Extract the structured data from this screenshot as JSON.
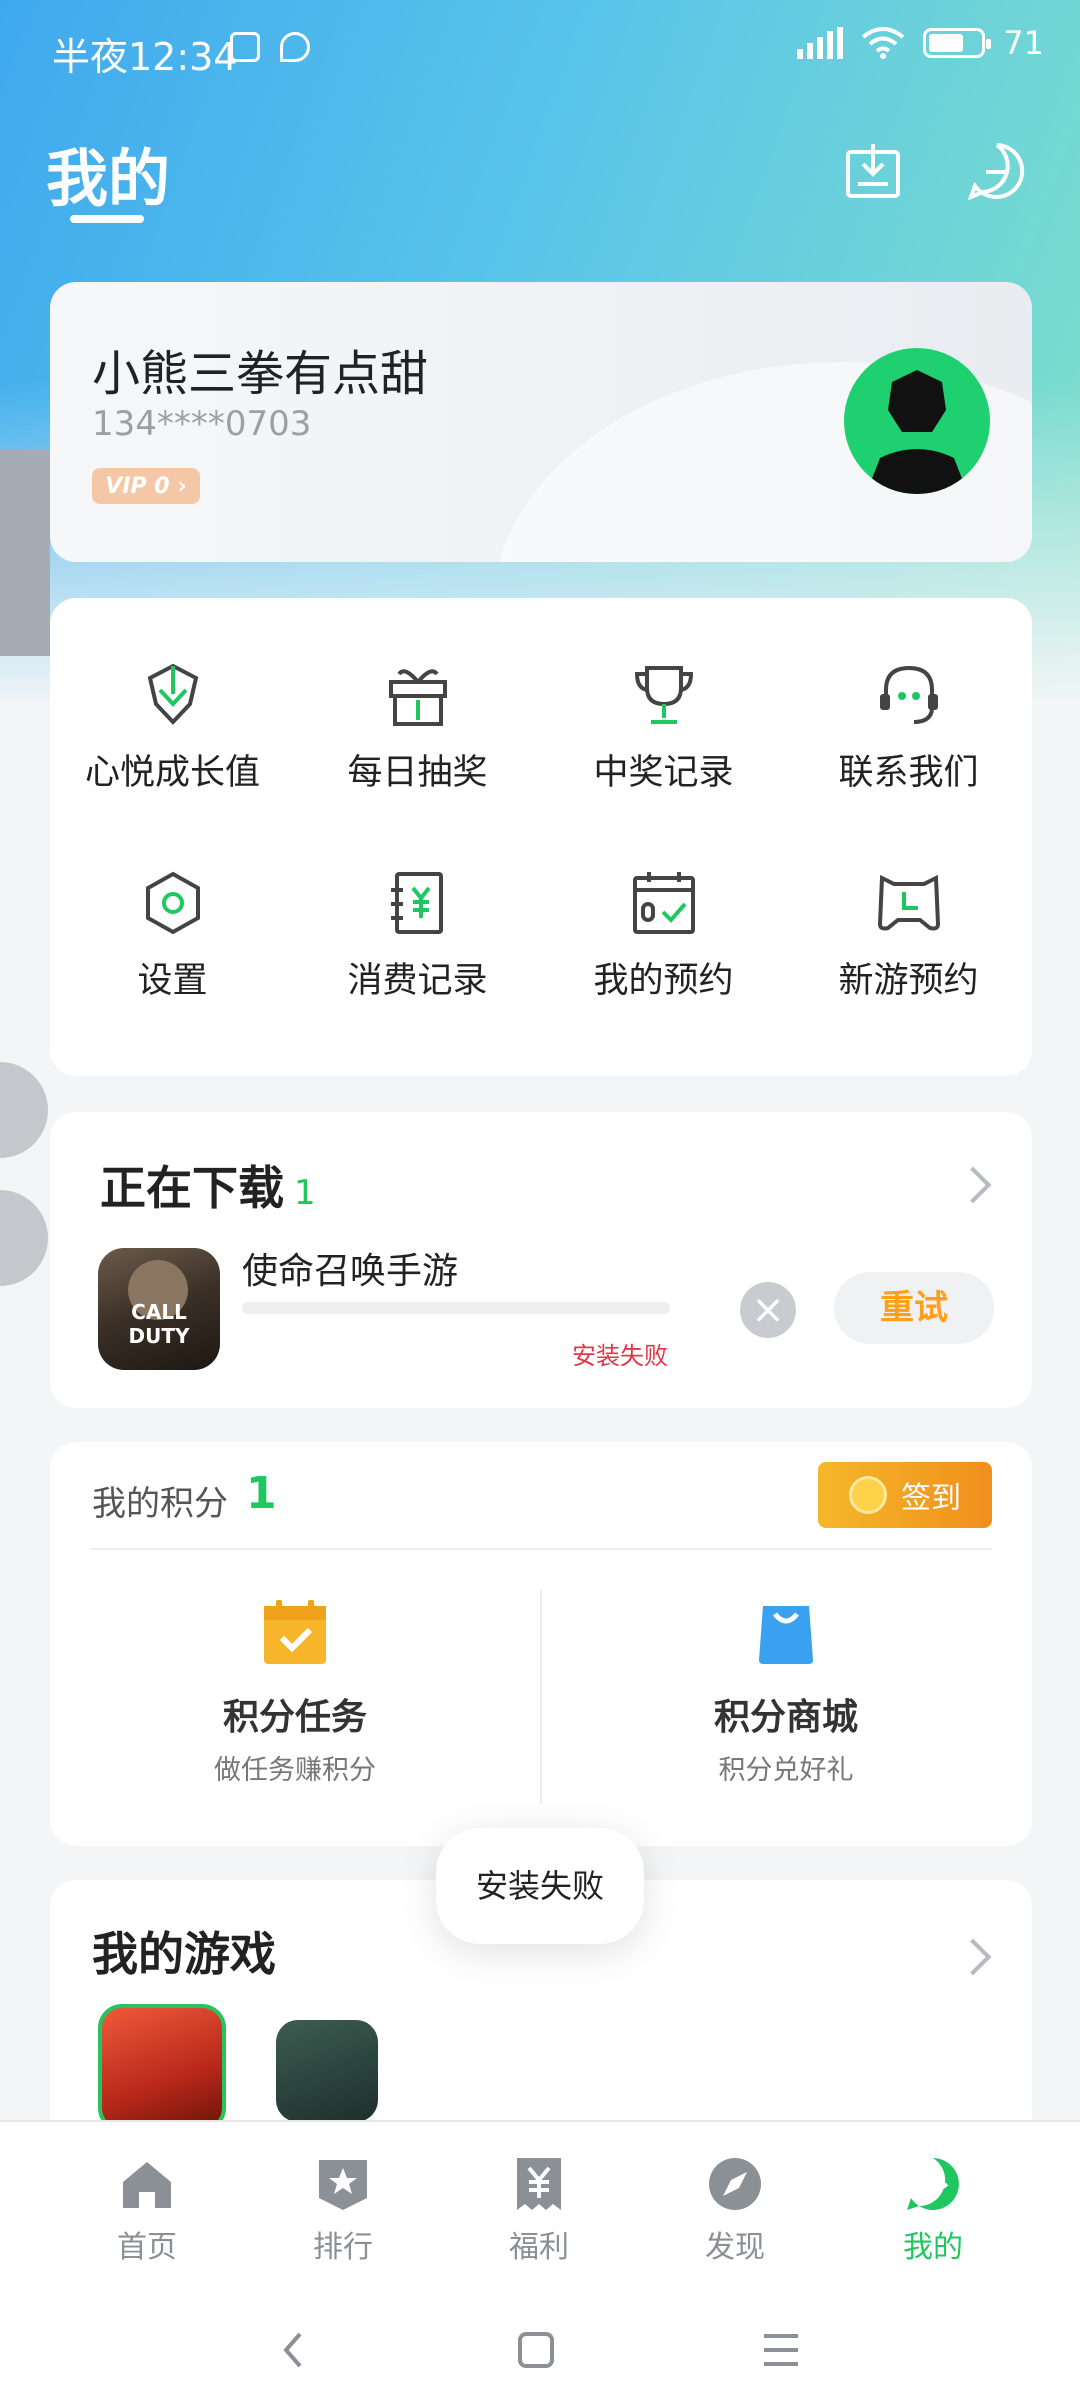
{
  "status_bar": {
    "time": "半夜12:34",
    "battery": "71"
  },
  "header": {
    "title": "我的"
  },
  "profile": {
    "name": "小熊三拳有点甜",
    "phone": "134****0703",
    "vip": "VIP 0"
  },
  "menu": {
    "items": [
      {
        "label": "心悦成长值",
        "icon": "diamond-icon"
      },
      {
        "label": "每日抽奖",
        "icon": "gift-icon"
      },
      {
        "label": "中奖记录",
        "icon": "trophy-icon"
      },
      {
        "label": "联系我们",
        "icon": "headset-icon"
      },
      {
        "label": "设置",
        "icon": "settings-icon"
      },
      {
        "label": "消费记录",
        "icon": "receipt-icon"
      },
      {
        "label": "我的预约",
        "icon": "calendar-icon"
      },
      {
        "label": "新游预约",
        "icon": "gamepad-icon"
      }
    ]
  },
  "downloads": {
    "title": "正在下载",
    "count": "1",
    "app_name": "使命召唤手游",
    "app_icon_text": "CALL DUTY",
    "status": "安装失败",
    "retry_label": "重试"
  },
  "points": {
    "label": "我的积分",
    "value": "1",
    "signin_label": "签到",
    "tasks_title": "积分任务",
    "tasks_sub": "做任务赚积分",
    "mall_title": "积分商城",
    "mall_sub": "积分兑好礼"
  },
  "my_games": {
    "title": "我的游戏"
  },
  "toast": {
    "text": "安装失败"
  },
  "tabs": [
    {
      "label": "首页",
      "icon": "home-icon"
    },
    {
      "label": "排行",
      "icon": "ranking-icon"
    },
    {
      "label": "福利",
      "icon": "welfare-icon"
    },
    {
      "label": "发现",
      "icon": "discover-icon"
    },
    {
      "label": "我的",
      "icon": "profile-icon"
    }
  ],
  "colors": {
    "accent": "#1fc760",
    "orange": "#f5a623",
    "error": "#e0384a"
  }
}
